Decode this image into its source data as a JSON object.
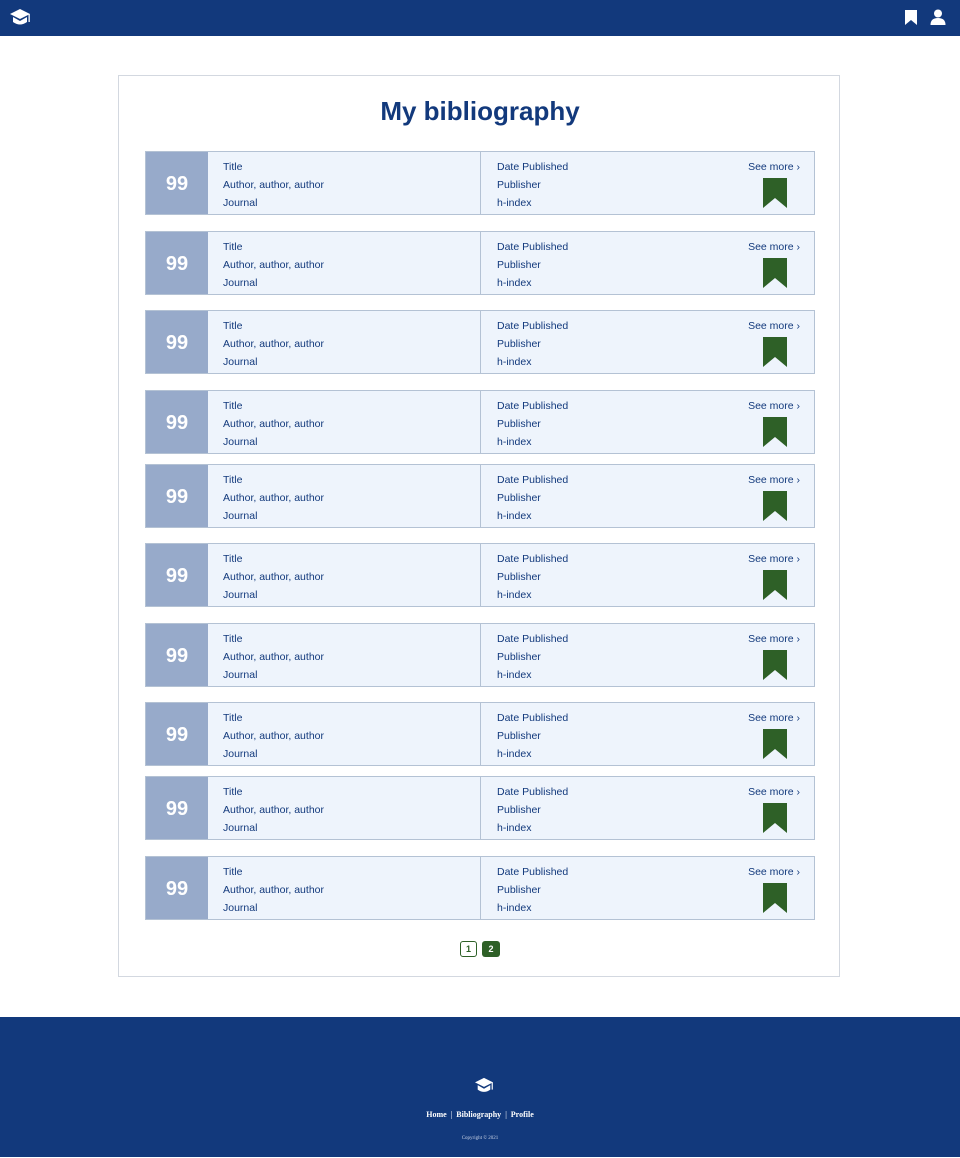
{
  "header": {
    "logo_icon": "graduation-cap-icon",
    "bookmark_icon": "bookmark-icon",
    "profile_icon": "user-icon"
  },
  "page": {
    "title": "My bibliography"
  },
  "entry_labels": {
    "score": "99",
    "title": "Title",
    "authors": "Author, author, author",
    "journal": "Journal",
    "date": "Date Published",
    "publisher": "Publisher",
    "hindex": "h-index",
    "see_more": "See more ›"
  },
  "entries": [
    {
      "score": "99",
      "title": "Title",
      "authors": "Author, author, author",
      "journal": "Journal",
      "date": "Date Published",
      "publisher": "Publisher",
      "hindex": "h-index",
      "see_more": "See more ›"
    },
    {
      "score": "99",
      "title": "Title",
      "authors": "Author, author, author",
      "journal": "Journal",
      "date": "Date Published",
      "publisher": "Publisher",
      "hindex": "h-index",
      "see_more": "See more ›"
    },
    {
      "score": "99",
      "title": "Title",
      "authors": "Author, author, author",
      "journal": "Journal",
      "date": "Date Published",
      "publisher": "Publisher",
      "hindex": "h-index",
      "see_more": "See more ›"
    },
    {
      "score": "99",
      "title": "Title",
      "authors": "Author, author, author",
      "journal": "Journal",
      "date": "Date Published",
      "publisher": "Publisher",
      "hindex": "h-index",
      "see_more": "See more ›"
    },
    {
      "score": "99",
      "title": "Title",
      "authors": "Author, author, author",
      "journal": "Journal",
      "date": "Date Published",
      "publisher": "Publisher",
      "hindex": "h-index",
      "see_more": "See more ›"
    },
    {
      "score": "99",
      "title": "Title",
      "authors": "Author, author, author",
      "journal": "Journal",
      "date": "Date Published",
      "publisher": "Publisher",
      "hindex": "h-index",
      "see_more": "See more ›"
    },
    {
      "score": "99",
      "title": "Title",
      "authors": "Author, author, author",
      "journal": "Journal",
      "date": "Date Published",
      "publisher": "Publisher",
      "hindex": "h-index",
      "see_more": "See more ›"
    },
    {
      "score": "99",
      "title": "Title",
      "authors": "Author, author, author",
      "journal": "Journal",
      "date": "Date Published",
      "publisher": "Publisher",
      "hindex": "h-index",
      "see_more": "See more ›"
    },
    {
      "score": "99",
      "title": "Title",
      "authors": "Author, author, author",
      "journal": "Journal",
      "date": "Date Published",
      "publisher": "Publisher",
      "hindex": "h-index",
      "see_more": "See more ›"
    },
    {
      "score": "99",
      "title": "Title",
      "authors": "Author, author, author",
      "journal": "Journal",
      "date": "Date Published",
      "publisher": "Publisher",
      "hindex": "h-index",
      "see_more": "See more ›"
    }
  ],
  "pagination": {
    "pages": [
      "1",
      "2"
    ],
    "current": "2"
  },
  "footer": {
    "links": [
      "Home",
      "Bibliography",
      "Profile"
    ],
    "copyright": "Copyright © 2021"
  },
  "colors": {
    "brand": "#12397c",
    "accent": "#2e6027",
    "score_bg": "#97aaca",
    "card_bg": "#eef4fc"
  }
}
